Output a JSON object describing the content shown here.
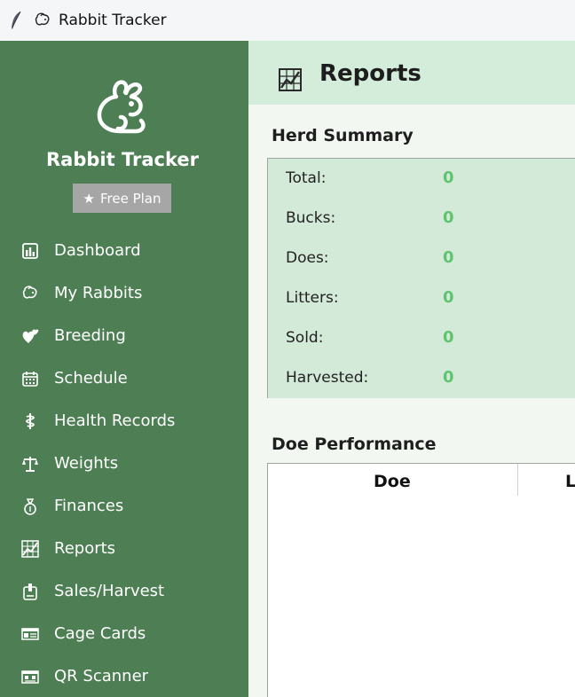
{
  "window": {
    "title": "Rabbit Tracker",
    "app_icon": "feather-icon",
    "title_icon": "rabbit-head-icon"
  },
  "sidebar": {
    "brand_icon": "rabbit-icon",
    "brand_name": "Rabbit Tracker",
    "plan_badge": "Free Plan",
    "plan_icon": "star-icon",
    "items": [
      {
        "label": "Dashboard",
        "icon": "bar-chart-icon"
      },
      {
        "label": "My Rabbits",
        "icon": "rabbit-head-icon"
      },
      {
        "label": "Breeding",
        "icon": "hearts-icon"
      },
      {
        "label": "Schedule",
        "icon": "calendar-icon"
      },
      {
        "label": "Health Records",
        "icon": "medical-icon"
      },
      {
        "label": "Weights",
        "icon": "scale-icon"
      },
      {
        "label": "Finances",
        "icon": "money-bag-icon"
      },
      {
        "label": "Reports",
        "icon": "reports-icon"
      },
      {
        "label": "Sales/Harvest",
        "icon": "sales-icon"
      },
      {
        "label": "Cage Cards",
        "icon": "id-card-icon"
      },
      {
        "label": "QR Scanner",
        "icon": "qr-scanner-icon"
      }
    ]
  },
  "main": {
    "title": "Reports",
    "title_icon": "reports-icon",
    "herd_summary": {
      "title": "Herd Summary",
      "rows": [
        {
          "label": "Total:",
          "value": "0"
        },
        {
          "label": "Bucks:",
          "value": "0"
        },
        {
          "label": "Does:",
          "value": "0"
        },
        {
          "label": "Litters:",
          "value": "0"
        },
        {
          "label": "Sold:",
          "value": "0"
        },
        {
          "label": "Harvested:",
          "value": "0"
        }
      ]
    },
    "doe_performance": {
      "title": "Doe Performance",
      "columns": [
        "Doe",
        "L"
      ]
    }
  },
  "colors": {
    "sidebar_bg": "#4e7f54",
    "header_bg": "#d4ecda",
    "summary_bg": "#d3ead8",
    "value_green": "#5fc46f",
    "badge_gray": "#a6a6a6"
  }
}
